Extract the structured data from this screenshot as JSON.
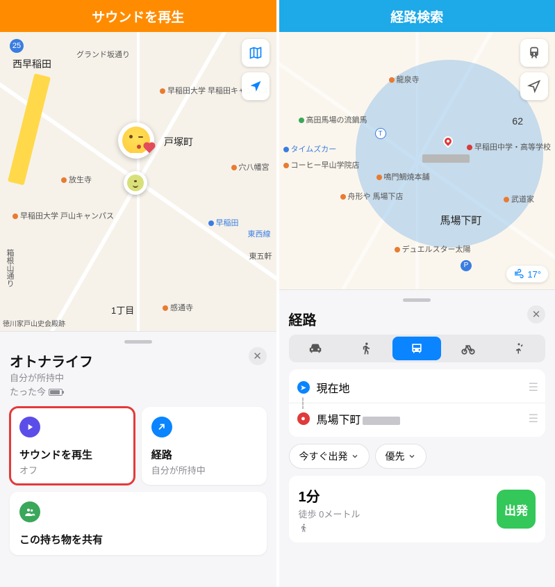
{
  "left": {
    "header": "サウンドを再生",
    "map_labels": {
      "nishiwaseda": "西早稲田",
      "grand": "グランド坂通り",
      "tozuka": "戸塚町",
      "waseda_u": "早稲田大学 早稲田キャンパス",
      "housenji": "放生寺",
      "toyama": "早稲田大学 戸山キャンパス",
      "waseda_st": "早稲田",
      "tozai": "東西線",
      "hakone": "箱根山通り",
      "chome": "1丁目",
      "kantsuji": "感通寺",
      "ana": "穴八幡宮",
      "higashi": "東五軒",
      "route_no": "25",
      "tokugawa": "徳川家戸山史会殿跡"
    },
    "sheet": {
      "title": "オトナライフ",
      "owner": "自分が所持中",
      "time": "たった今",
      "play_title": "サウンドを再生",
      "play_sub": "オフ",
      "route_title": "経路",
      "route_sub": "自分が所持中",
      "share_title": "この持ち物を共有"
    }
  },
  "right": {
    "header": "経路検索",
    "map_labels": {
      "ryusenji": "龍泉寺",
      "rukomauma": "高田馬場の流鏑馬",
      "times": "タイムズカー",
      "coffee": "コーヒー早山学院店",
      "naruto": "鳴門鯛焼本舗",
      "funaya": "舟形や 馬場下店",
      "babashita": "馬場下町",
      "duel": "デュエルスター太陽",
      "waseda_hs": "早稲田中学・高等学校",
      "budokan": "武道家",
      "num": "62",
      "t_exit": "T",
      "p": "P"
    },
    "temp": "17°",
    "sheet": {
      "title": "経路",
      "from": "現在地",
      "to_prefix": "馬場下町",
      "depart_now": "今すぐ出発",
      "priority": "優先",
      "duration": "1分",
      "distance": "徒歩 0メートル",
      "go": "出発"
    }
  }
}
